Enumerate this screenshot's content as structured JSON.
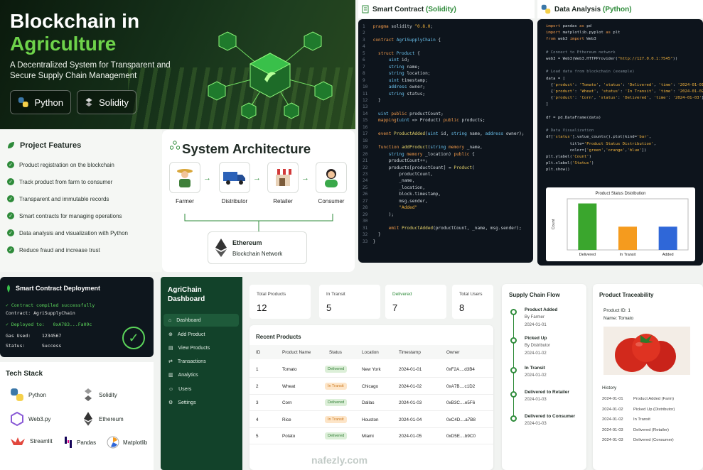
{
  "hero": {
    "title_line1": "Blockchain in",
    "title_line2": "Agriculture",
    "subtitle": "A Decentralized System for Transparent and Secure Supply Chain Management",
    "badges": [
      {
        "label": "Python",
        "icon": "python-icon"
      },
      {
        "label": "Solidity",
        "icon": "solidity-icon"
      }
    ]
  },
  "features": {
    "title": "Project Features",
    "items": [
      "Product registration on the blockchain",
      "Track product from farm to consumer",
      "Transparent and immutable records",
      "Smart contracts for managing operations",
      "Data analysis and visualization with Python",
      "Reduce fraud and increase trust"
    ]
  },
  "architecture": {
    "title": "System Architecture",
    "nodes": [
      "Farmer",
      "Distributor",
      "Retailer",
      "Consumer"
    ],
    "chain_title": "Ethereum",
    "chain_sub": "Blockchain Network"
  },
  "solidity": {
    "title_prefix": "Smart Contract ",
    "title_accent": "(Solidity)"
  },
  "python": {
    "title_prefix": "Data Analysis ",
    "title_accent": "(Python)"
  },
  "mini_chart": {
    "title": "Product Status Distribution",
    "xlabel": "Status",
    "ylabel": "Count"
  },
  "chart_data": {
    "type": "bar",
    "title": "Product Status Distribution",
    "categories": [
      "Delivered",
      "In Transit",
      "Added"
    ],
    "values": [
      2,
      1,
      1
    ],
    "colors": [
      "#3aa62d",
      "#f59b1e",
      "#2f67d8"
    ],
    "xlabel": "Status",
    "ylabel": "Count",
    "ylim": [
      0,
      2.2
    ]
  },
  "deploy": {
    "title": "Smart Contract Deployment",
    "lines": [
      "✓ Contract compiled successfully",
      "Contract: AgriSupplyChain",
      "✓ Deployed to:   0xA783...Fa09c",
      "Gas Used:    1234567",
      "Status:      Success"
    ]
  },
  "tech": {
    "title": "Tech Stack",
    "items": [
      "Python",
      "Solidity",
      "Web3.py",
      "Ethereum",
      "Streamlit",
      "Pandas",
      "Matplotlib"
    ]
  },
  "dashboard": {
    "brand_line1": "AgriChain",
    "brand_line2": "Dashboard",
    "nav": [
      "Dashboard",
      "Add Product",
      "View Products",
      "Transactions",
      "Analytics",
      "Users",
      "Settings"
    ]
  },
  "stats": [
    {
      "label": "Total Products",
      "value": "12"
    },
    {
      "label": "In Transit",
      "value": "5"
    },
    {
      "label": "Delivered",
      "value": "7"
    },
    {
      "label": "Total Users",
      "value": "8"
    }
  ],
  "recent": {
    "title": "Recent Products",
    "headers": [
      "ID",
      "Product Name",
      "Status",
      "Location",
      "Timestamp",
      "Owner"
    ],
    "rows": [
      [
        "1",
        "Tomato",
        "Delivered",
        "New York",
        "2024-01-01",
        "0xF2A....d3B4"
      ],
      [
        "2",
        "Wheat",
        "In Transit",
        "Chicago",
        "2024-01-02",
        "0xA7B....c1D2"
      ],
      [
        "3",
        "Corn",
        "Delivered",
        "Dallas",
        "2024-01-03",
        "0xB3C....e5F6"
      ],
      [
        "4",
        "Rice",
        "In Transit",
        "Houston",
        "2024-01-04",
        "0xC4D....a7B8"
      ],
      [
        "5",
        "Potato",
        "Delivered",
        "Miami",
        "2024-01-05",
        "0xD5E....b9C0"
      ]
    ]
  },
  "flow": {
    "title": "Supply Chain Flow",
    "steps": [
      {
        "title": "Product Added",
        "by": "By Farmer",
        "date": "2024-01-01"
      },
      {
        "title": "Picked Up",
        "by": "By Distributor",
        "date": "2024-01-02"
      },
      {
        "title": "In Transit",
        "by": "",
        "date": "2024-01-02"
      },
      {
        "title": "Delivered to Retailer",
        "by": "",
        "date": "2024-01-03"
      },
      {
        "title": "Delivered to Consumer",
        "by": "",
        "date": "2024-01-03"
      }
    ]
  },
  "trace": {
    "title": "Product Traceability",
    "product_id": "Product ID: 1",
    "name": "Name: Tomato",
    "history_title": "History",
    "history": [
      [
        "2024-01-01",
        "Product Added (Farm)"
      ],
      [
        "2024-01-02",
        "Picked Up (Distributor)"
      ],
      [
        "2024-01-02",
        "In Transit"
      ],
      [
        "2024-01-03",
        "Delivered (Retailer)"
      ],
      [
        "2024-01-03",
        "Delivered (Consumer)"
      ]
    ]
  },
  "watermark": "nafezly.com"
}
